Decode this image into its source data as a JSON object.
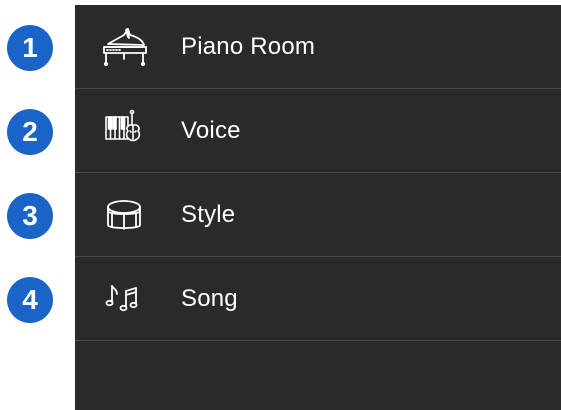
{
  "callouts": [
    {
      "number": "1",
      "color": "#1a64c8"
    },
    {
      "number": "2",
      "color": "#1a64c8"
    },
    {
      "number": "3",
      "color": "#1a64c8"
    },
    {
      "number": "4",
      "color": "#1a64c8"
    }
  ],
  "menu": {
    "background": "#2a2a2a",
    "items": [
      {
        "label": "Piano Room",
        "icon": "grand-piano-icon"
      },
      {
        "label": "Voice",
        "icon": "keyboard-violin-icon"
      },
      {
        "label": "Style",
        "icon": "drum-icon"
      },
      {
        "label": "Song",
        "icon": "music-notes-icon"
      }
    ]
  }
}
